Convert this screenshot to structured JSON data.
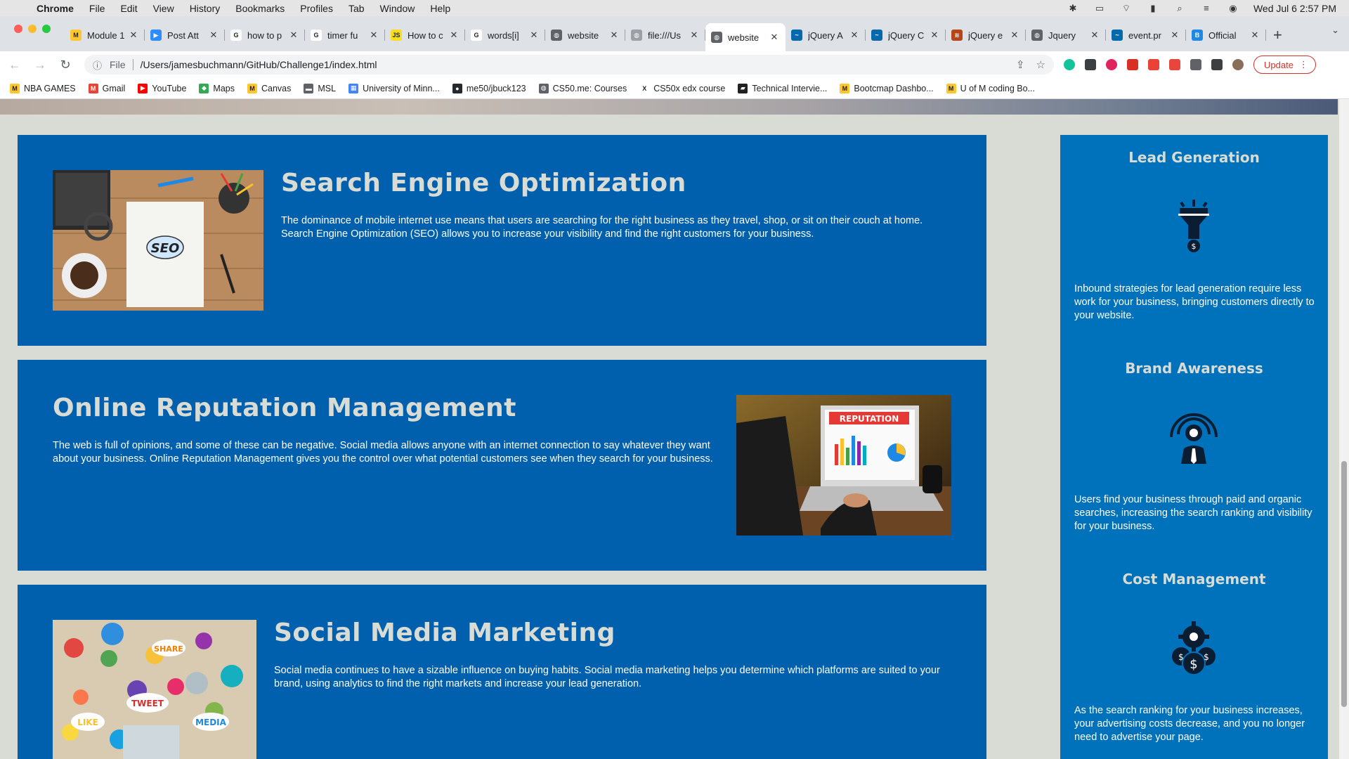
{
  "menubar": {
    "app": "Chrome",
    "items": [
      "File",
      "Edit",
      "View",
      "History",
      "Bookmarks",
      "Profiles",
      "Tab",
      "Window",
      "Help"
    ],
    "clock": "Wed Jul 6  2:57 PM"
  },
  "tabs": [
    {
      "label": "Module 1",
      "favicon_color": "#ffc72c",
      "favicon_glyph": "M"
    },
    {
      "label": "Post Att",
      "favicon_color": "#2d8cff",
      "favicon_glyph": "▶"
    },
    {
      "label": "how to p",
      "favicon_color": "#ffffff",
      "favicon_glyph": "G"
    },
    {
      "label": "timer fu",
      "favicon_color": "#ffffff",
      "favicon_glyph": "G"
    },
    {
      "label": "How to c",
      "favicon_color": "#f7df1e",
      "favicon_glyph": "JS"
    },
    {
      "label": "words[i]",
      "favicon_color": "#ffffff",
      "favicon_glyph": "G"
    },
    {
      "label": "website",
      "favicon_color": "#5f6368",
      "favicon_glyph": "◍"
    },
    {
      "label": "file:///Us",
      "favicon_color": "#9aa0a6",
      "favicon_glyph": "◍"
    },
    {
      "label": "website",
      "favicon_color": "#5f6368",
      "favicon_glyph": "◍",
      "active": true
    },
    {
      "label": "jQuery A",
      "favicon_color": "#0769ad",
      "favicon_glyph": "~"
    },
    {
      "label": "jQuery C",
      "favicon_color": "#0769ad",
      "favicon_glyph": "~"
    },
    {
      "label": "jQuery e",
      "favicon_color": "#b5451b",
      "favicon_glyph": "≋"
    },
    {
      "label": "Jquery",
      "favicon_color": "#5f6368",
      "favicon_glyph": "◍"
    },
    {
      "label": "event.pr",
      "favicon_color": "#0769ad",
      "favicon_glyph": "~"
    },
    {
      "label": "Official",
      "favicon_color": "#1e88e5",
      "favicon_glyph": "B"
    }
  ],
  "toolbar": {
    "scheme": "File",
    "url": "/Users/jamesbuchmann/GitHub/Challenge1/index.html",
    "update_label": "Update"
  },
  "bookmarks": [
    {
      "label": "NBA GAMES",
      "color": "#ffc72c",
      "glyph": "M"
    },
    {
      "label": "Gmail",
      "color": "#ea4335",
      "glyph": "M"
    },
    {
      "label": "YouTube",
      "color": "#ff0000",
      "glyph": "▶"
    },
    {
      "label": "Maps",
      "color": "#34a853",
      "glyph": "◆"
    },
    {
      "label": "Canvas",
      "color": "#ffc72c",
      "glyph": "M"
    },
    {
      "label": "MSL",
      "color": "#5f6368",
      "glyph": "▬"
    },
    {
      "label": "University of Minn...",
      "color": "#4285f4",
      "glyph": "▦"
    },
    {
      "label": "me50/jbuck123",
      "color": "#24292e",
      "glyph": "●"
    },
    {
      "label": "CS50.me: Courses",
      "color": "#5f6368",
      "glyph": "◍"
    },
    {
      "label": "CS50x edx course",
      "color": "#ffffff",
      "glyph": "X"
    },
    {
      "label": "Technical Intervie...",
      "color": "#202124",
      "glyph": "▰"
    },
    {
      "label": "Bootcmap Dashbo...",
      "color": "#ffc72c",
      "glyph": "M"
    },
    {
      "label": "U of M coding Bo...",
      "color": "#ffc72c",
      "glyph": "M"
    }
  ],
  "content": [
    {
      "id": "search-engine-optimization",
      "title": "Search Engine Optimization",
      "text": "The dominance of mobile internet use means that users are searching for the right business as they travel, shop, or sit on their couch at home. Search Engine Optimization (SEO) allows you to increase your visibility and find the right customers for your business.",
      "image_alt": "SEO"
    },
    {
      "id": "online-reputation-management",
      "title": "Online Reputation Management",
      "text": "The web is full of opinions, and some of these can be negative. Social media allows anyone with an internet connection to say whatever they want about your business. Online Reputation Management gives you the control over what potential customers see when they search for your business.",
      "image_alt": "REPUTATION"
    },
    {
      "id": "social-media-marketing",
      "title": "Social Media Marketing",
      "text": "Social media continues to have a sizable influence on buying habits. Social media marketing helps you determine which platforms are suited to your brand, using analytics to find the right markets and increase your lead generation.",
      "image_labels": [
        "SHARE",
        "TWEET",
        "LIKE",
        "MEDIA"
      ]
    }
  ],
  "benefits": [
    {
      "title": "Lead Generation",
      "icon": "lead-generation-icon",
      "text": "Inbound strategies for lead generation require less work for your business, bringing customers directly to your website."
    },
    {
      "title": "Brand Awareness",
      "icon": "brand-awareness-icon",
      "text": "Users find your business through paid and organic searches, increasing the search ranking and visibility for your business."
    },
    {
      "title": "Cost Management",
      "icon": "cost-management-icon",
      "text": "As the search ranking for your business increases, your advertising costs decrease, and you no longer need to advertise your page."
    }
  ],
  "colors": {
    "content_bg": "#0160ae",
    "sidebar_bg": "#0072bb",
    "heading": "#d9dbd5",
    "page_bg": "#d9dbd5"
  }
}
